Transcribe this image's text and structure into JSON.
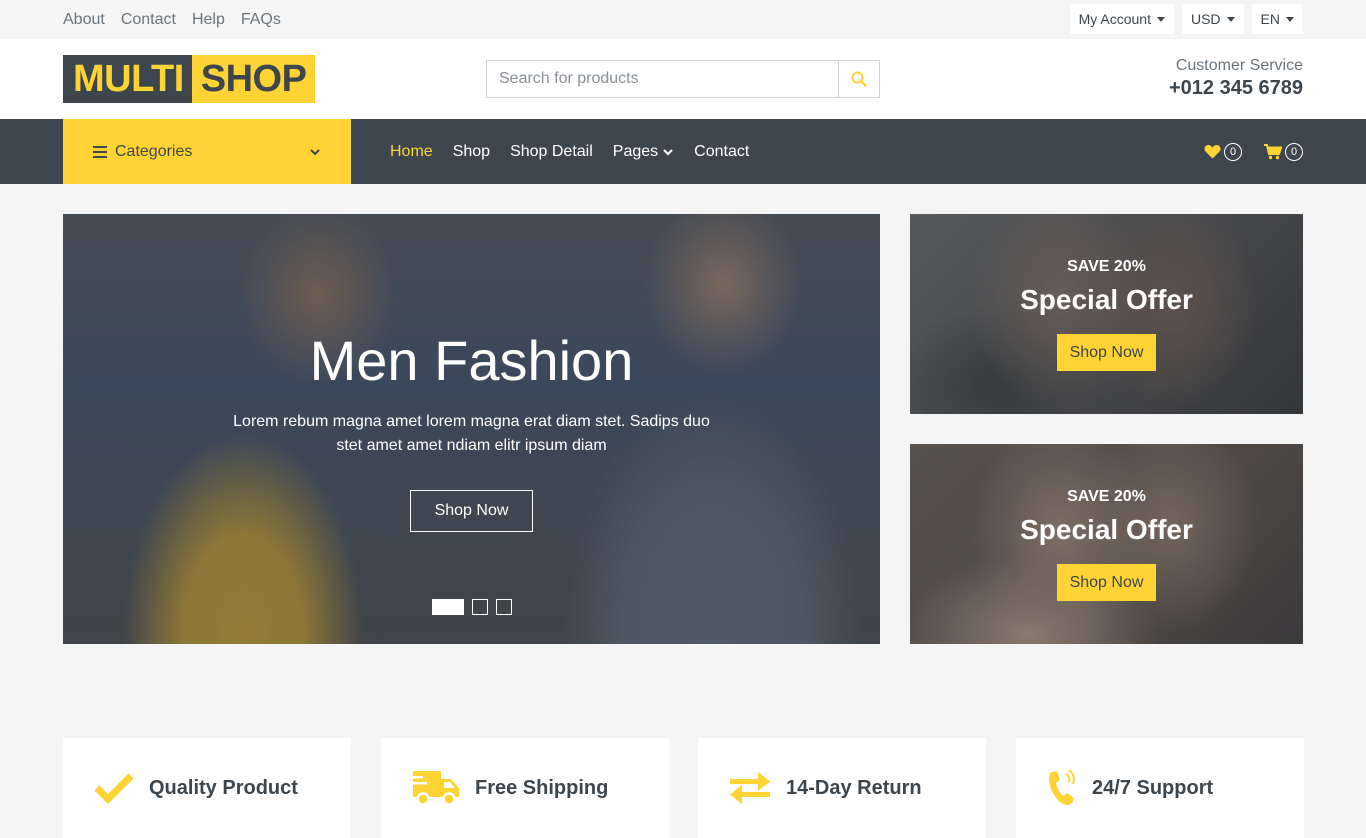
{
  "topbar": {
    "links": [
      "About",
      "Contact",
      "Help",
      "FAQs"
    ],
    "account": "My Account",
    "currency": "USD",
    "language": "EN"
  },
  "header": {
    "logo_part1": "MULTI",
    "logo_part2": "SHOP",
    "search_placeholder": "Search for products",
    "cs_label": "Customer Service",
    "cs_phone": "+012 345 6789"
  },
  "nav": {
    "categories": "Categories",
    "items": [
      "Home",
      "Shop",
      "Shop Detail",
      "Pages",
      "Contact"
    ],
    "wishlist_count": "0",
    "cart_count": "0"
  },
  "hero": {
    "title": "Men Fashion",
    "text": "Lorem rebum magna amet lorem magna erat diam stet. Sadips duo stet amet amet ndiam elitr ipsum diam",
    "button": "Shop Now"
  },
  "offers": [
    {
      "save": "Save 20%",
      "title": "Special Offer",
      "button": "Shop Now"
    },
    {
      "save": "Save 20%",
      "title": "Special Offer",
      "button": "Shop Now"
    }
  ],
  "features": [
    "Quality Product",
    "Free Shipping",
    "14-Day Return",
    "24/7 Support"
  ],
  "colors": {
    "accent": "#FFD333",
    "dark": "#3D464D",
    "light": "#F5F5F5"
  }
}
